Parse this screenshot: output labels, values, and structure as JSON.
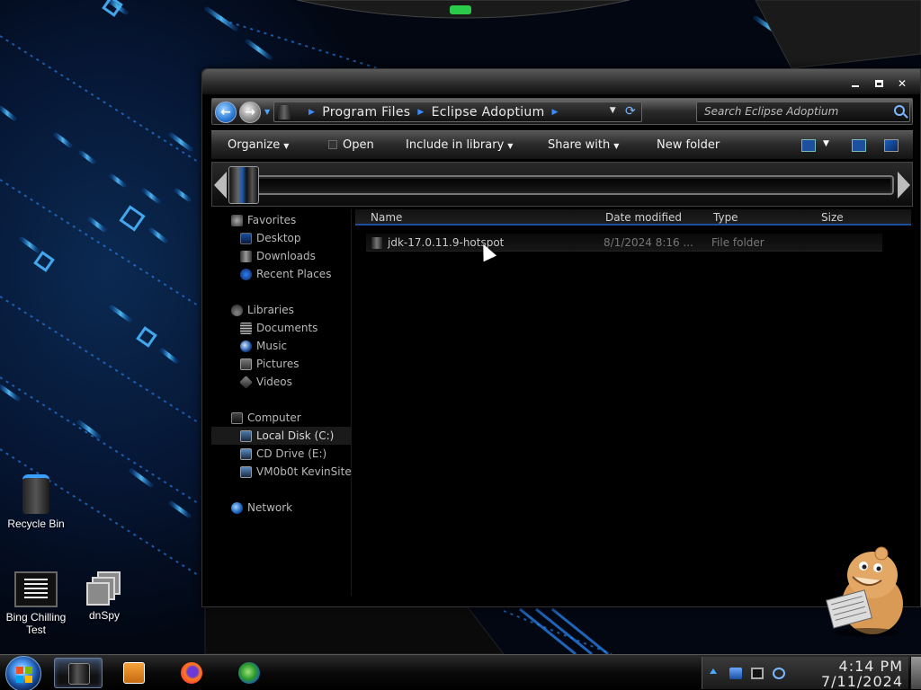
{
  "desktop": {
    "icons": [
      {
        "label": "Recycle Bin"
      },
      {
        "label": "Bing Chilling Test"
      },
      {
        "label": "dnSpy"
      }
    ]
  },
  "explorer": {
    "breadcrumb": [
      "Program Files",
      "Eclipse Adoptium"
    ],
    "search_placeholder": "Search Eclipse Adoptium",
    "toolbar": {
      "organize": "Organize",
      "open": "Open",
      "include_in_library": "Include in library",
      "share_with": "Share with",
      "new_folder": "New folder"
    },
    "nav": {
      "favorites": "Favorites",
      "desktop": "Desktop",
      "downloads": "Downloads",
      "recent_places": "Recent Places",
      "libraries": "Libraries",
      "documents": "Documents",
      "music": "Music",
      "pictures": "Pictures",
      "videos": "Videos",
      "computer": "Computer",
      "local_disk": "Local Disk (C:)",
      "cd_drive": "CD Drive (E:)",
      "vmbox": "VM0b0t KevinSite",
      "network": "Network"
    },
    "columns": {
      "name": "Name",
      "date_modified": "Date modified",
      "type": "Type",
      "size": "Size"
    },
    "files": [
      {
        "name": "jdk-17.0.11.9-hotspot",
        "date_modified": "8/1/2024 8:16 ...",
        "type": "File folder",
        "size": ""
      }
    ]
  },
  "taskbar": {
    "clock_time": "4:14 PM",
    "clock_date": "7/11/2024"
  },
  "colors": {
    "accent_blue": "#1d4f9e",
    "wallpaper_glow": "#2aa0ff"
  }
}
